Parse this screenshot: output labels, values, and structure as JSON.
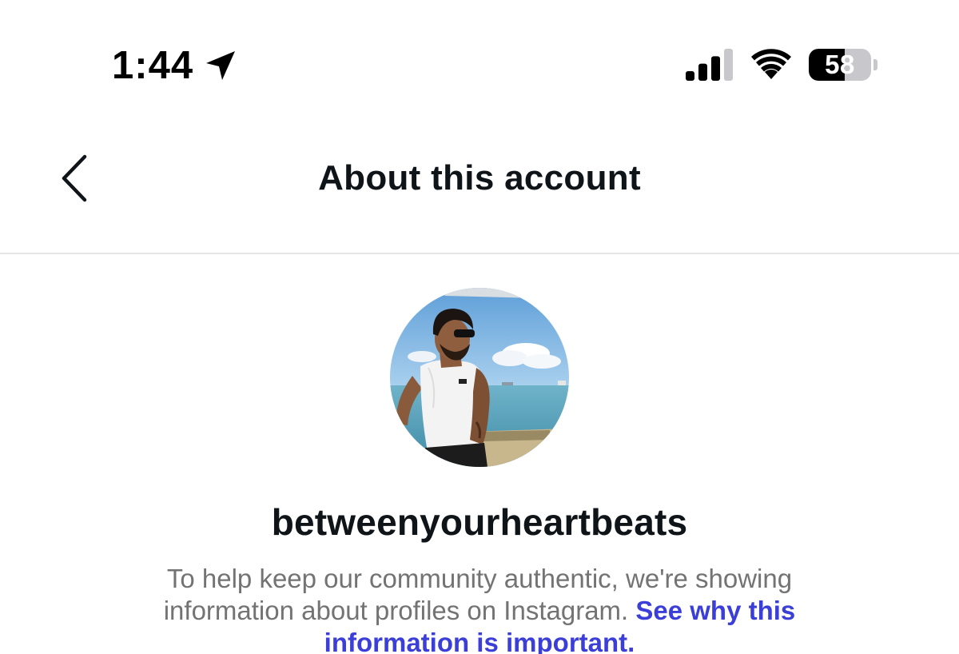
{
  "status_bar": {
    "time": "1:44",
    "location_icon": "location-arrow-icon",
    "signal_icon": "cellular-signal-icon",
    "signal_bars_active": 3,
    "signal_bars_total": 4,
    "wifi_icon": "wifi-icon",
    "battery_percent": "58",
    "battery_level_fraction": 0.58
  },
  "nav": {
    "back_icon": "chevron-left-icon",
    "title": "About this account"
  },
  "profile": {
    "avatar": "profile-photo",
    "username": "betweenyourheartbeats"
  },
  "info": {
    "text": "To help keep our community authentic, we're showing information about profiles on Instagram. ",
    "link_text": "See why this information is important."
  },
  "colors": {
    "link": "#3b3fd8",
    "secondary_text": "#737373",
    "primary_text": "#0f1419",
    "divider": "#e6e6e6"
  }
}
